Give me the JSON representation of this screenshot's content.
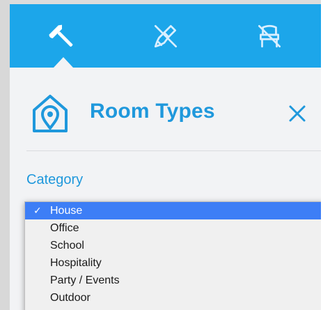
{
  "toolbar": {
    "tabs": [
      {
        "icon": "hammer-icon",
        "active": true
      },
      {
        "icon": "paint-brush-off-icon",
        "active": false
      },
      {
        "icon": "chair-off-icon",
        "active": false
      }
    ],
    "color": "#1ca6ea"
  },
  "header": {
    "title": "Room Types",
    "icon": "house-location-icon",
    "close_icon": "close-icon"
  },
  "category": {
    "label": "Category",
    "options": [
      "House",
      "Office",
      "School",
      "Hospitality",
      "Party / Events",
      "Outdoor"
    ],
    "selected": "House",
    "check_mark": "✓"
  },
  "colors": {
    "accent": "#1f98dc",
    "selection": "#3d7ef6"
  }
}
